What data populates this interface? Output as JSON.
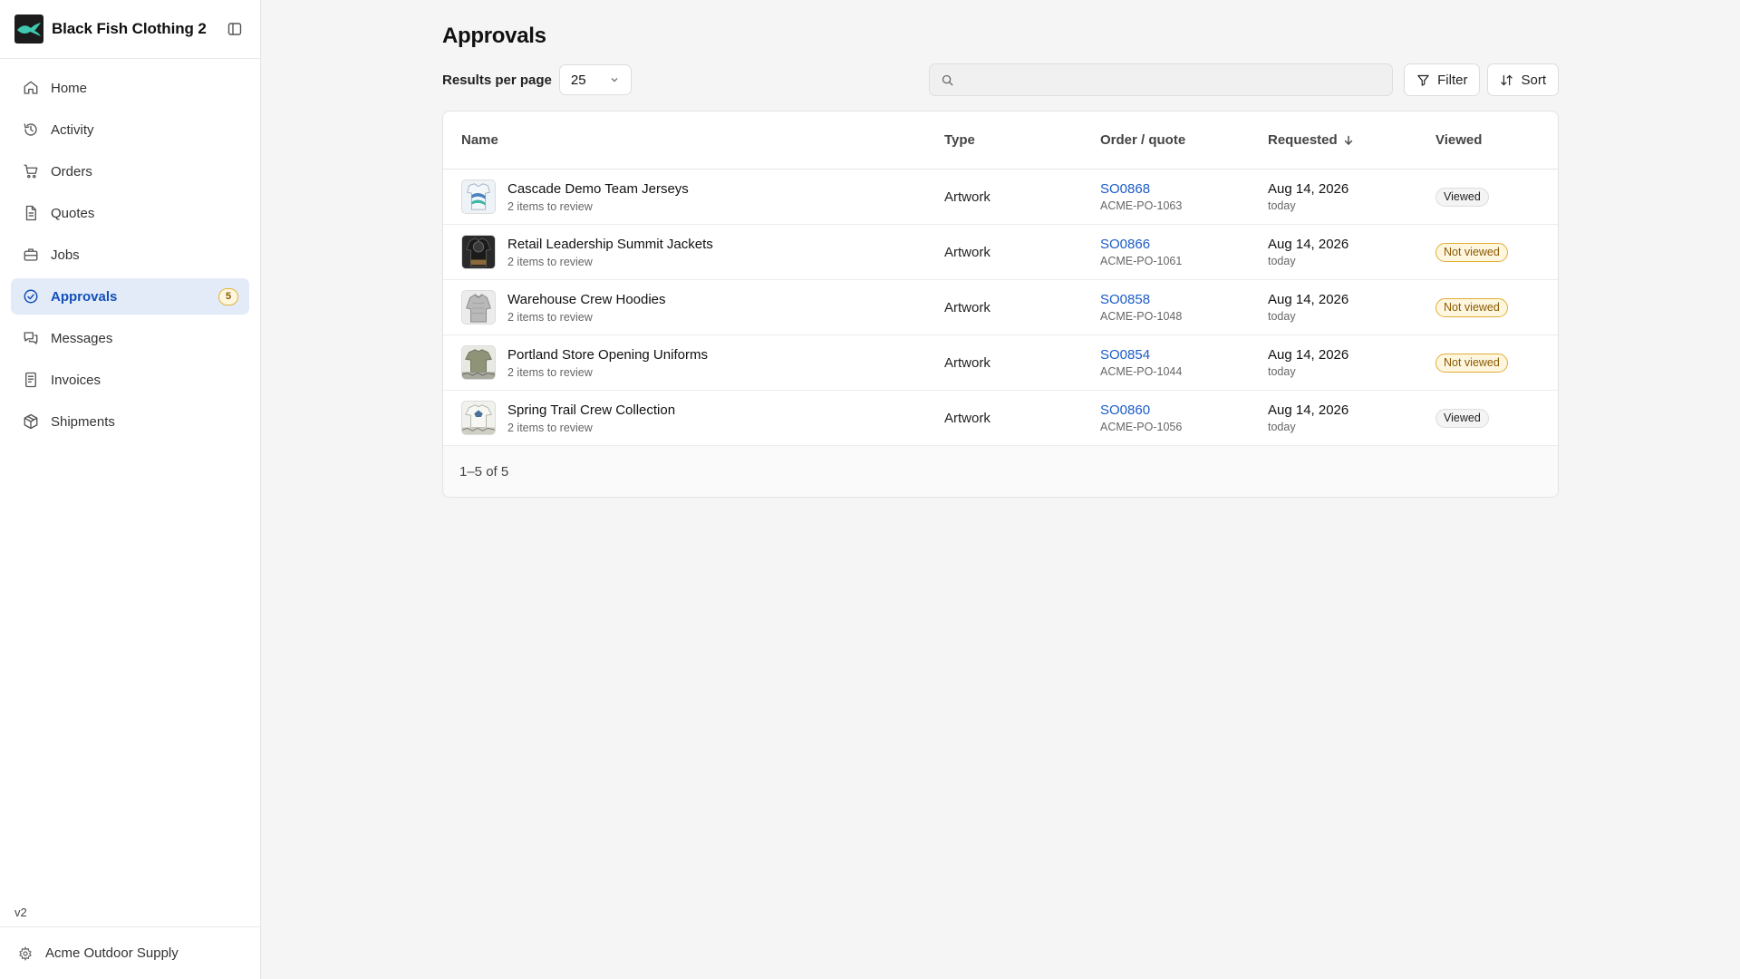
{
  "brand": {
    "name": "Black Fish Clothing 2"
  },
  "sidebar": {
    "items": [
      {
        "label": "Home",
        "icon": "home-icon"
      },
      {
        "label": "Activity",
        "icon": "history-icon"
      },
      {
        "label": "Orders",
        "icon": "cart-icon"
      },
      {
        "label": "Quotes",
        "icon": "document-icon"
      },
      {
        "label": "Jobs",
        "icon": "briefcase-icon"
      },
      {
        "label": "Approvals",
        "icon": "check-circle-icon",
        "active": true,
        "badge": "5"
      },
      {
        "label": "Messages",
        "icon": "messages-icon"
      },
      {
        "label": "Invoices",
        "icon": "invoice-icon"
      },
      {
        "label": "Shipments",
        "icon": "package-icon"
      }
    ],
    "version": "v2",
    "footer_label": "Acme Outdoor Supply"
  },
  "page": {
    "title": "Approvals"
  },
  "toolbar": {
    "results_per_page_label": "Results per page",
    "results_per_page_value": "25",
    "search_value": "",
    "filter_label": "Filter",
    "sort_label": "Sort"
  },
  "table": {
    "headers": {
      "name": "Name",
      "type": "Type",
      "order": "Order / quote",
      "requested": "Requested",
      "viewed": "Viewed"
    },
    "rows": [
      {
        "name": "Cascade Demo Team Jerseys",
        "sub": "2 items to review",
        "type": "Artwork",
        "order": "SO0868",
        "po": "ACME-PO-1063",
        "date": "Aug 14, 2026",
        "rel": "today",
        "viewed": "Viewed",
        "viewed_state": "viewed"
      },
      {
        "name": "Retail Leadership Summit Jackets",
        "sub": "2 items to review",
        "type": "Artwork",
        "order": "SO0866",
        "po": "ACME-PO-1061",
        "date": "Aug 14, 2026",
        "rel": "today",
        "viewed": "Not viewed",
        "viewed_state": "not"
      },
      {
        "name": "Warehouse Crew Hoodies",
        "sub": "2 items to review",
        "type": "Artwork",
        "order": "SO0858",
        "po": "ACME-PO-1048",
        "date": "Aug 14, 2026",
        "rel": "today",
        "viewed": "Not viewed",
        "viewed_state": "not"
      },
      {
        "name": "Portland Store Opening Uniforms",
        "sub": "2 items to review",
        "type": "Artwork",
        "order": "SO0854",
        "po": "ACME-PO-1044",
        "date": "Aug 14, 2026",
        "rel": "today",
        "viewed": "Not viewed",
        "viewed_state": "not"
      },
      {
        "name": "Spring Trail Crew Collection",
        "sub": "2 items to review",
        "type": "Artwork",
        "order": "SO0860",
        "po": "ACME-PO-1056",
        "date": "Aug 14, 2026",
        "rel": "today",
        "viewed": "Viewed",
        "viewed_state": "viewed"
      }
    ],
    "pagination": "1–5 of 5"
  },
  "colors": {
    "accent": "#1550b8",
    "link": "#1a5bc8",
    "badge_warn_border": "#e2ad34",
    "badge_warn_bg": "#fff6e0",
    "active_bg": "#e3ebf8"
  }
}
